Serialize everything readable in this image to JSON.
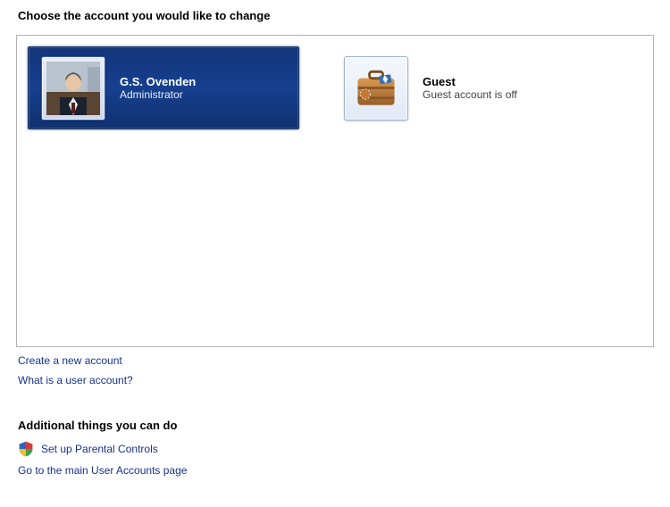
{
  "title": "Choose the account you would like to change",
  "accounts": [
    {
      "name": "G.S. Ovenden",
      "role": "Administrator",
      "selected": true
    },
    {
      "name": "Guest",
      "role": "Guest account is off",
      "selected": false
    }
  ],
  "links": {
    "create": "Create a new account",
    "whatis": "What is a user account?"
  },
  "additional": {
    "heading": "Additional things you can do",
    "parental": "Set up Parental Controls",
    "mainpage": "Go to the main User Accounts page"
  }
}
